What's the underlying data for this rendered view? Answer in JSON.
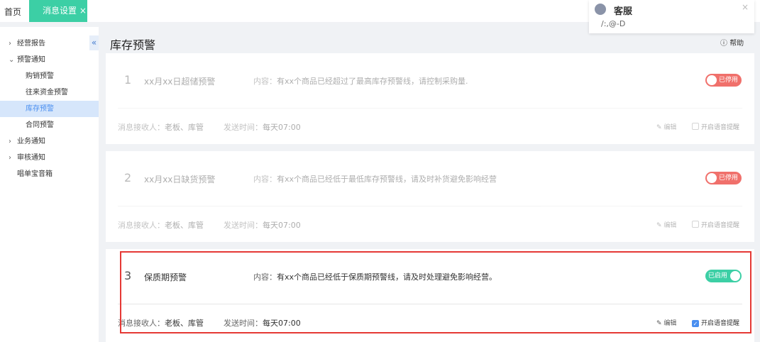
{
  "tabs": {
    "home": "首页",
    "active": "消息设置",
    "close": "×"
  },
  "sidebar": {
    "collapse": "«",
    "items": [
      {
        "arrow": "›",
        "label": "经营报告"
      },
      {
        "arrow": "⌄",
        "label": "预警通知"
      },
      {
        "label": "购销预警"
      },
      {
        "label": "往来资金预警"
      },
      {
        "label": "库存预警"
      },
      {
        "label": "合同预警"
      },
      {
        "arrow": "›",
        "label": "业务通知"
      },
      {
        "arrow": "›",
        "label": "审核通知"
      },
      {
        "label": "唱单宝音箱"
      }
    ]
  },
  "page": {
    "title": "库存预警",
    "help": "帮助"
  },
  "labels": {
    "content": "内容：",
    "receivers": "消息接收人：",
    "send_time": "发送时间：",
    "edit": "编辑",
    "voice": "开启语音提醒"
  },
  "cards": [
    {
      "num": "1",
      "name": "xx月xx日超储预警",
      "content": "有xx个商品已经超过了最高库存预警线，请控制采购量.",
      "receivers": "老板、库管",
      "time": "每天07:00",
      "status": "已停用",
      "enabled": false,
      "voice": false
    },
    {
      "num": "2",
      "name": "xx月xx日缺货预警",
      "content": "有xx个商品已经低于最低库存预警线，请及时补货避免影响经营",
      "receivers": "老板、库管",
      "time": "每天07:00",
      "status": "已停用",
      "enabled": false,
      "voice": false
    },
    {
      "num": "3",
      "name": "保质期预警",
      "content": "有xx个商品已经低于保质期预警线，请及时处理避免影响经营。",
      "receivers": "老板、库管",
      "time": "每天07:00",
      "status": "已启用",
      "enabled": true,
      "voice": true
    }
  ],
  "popup": {
    "title": "客服",
    "message": "/:,@-D",
    "close": "×"
  }
}
